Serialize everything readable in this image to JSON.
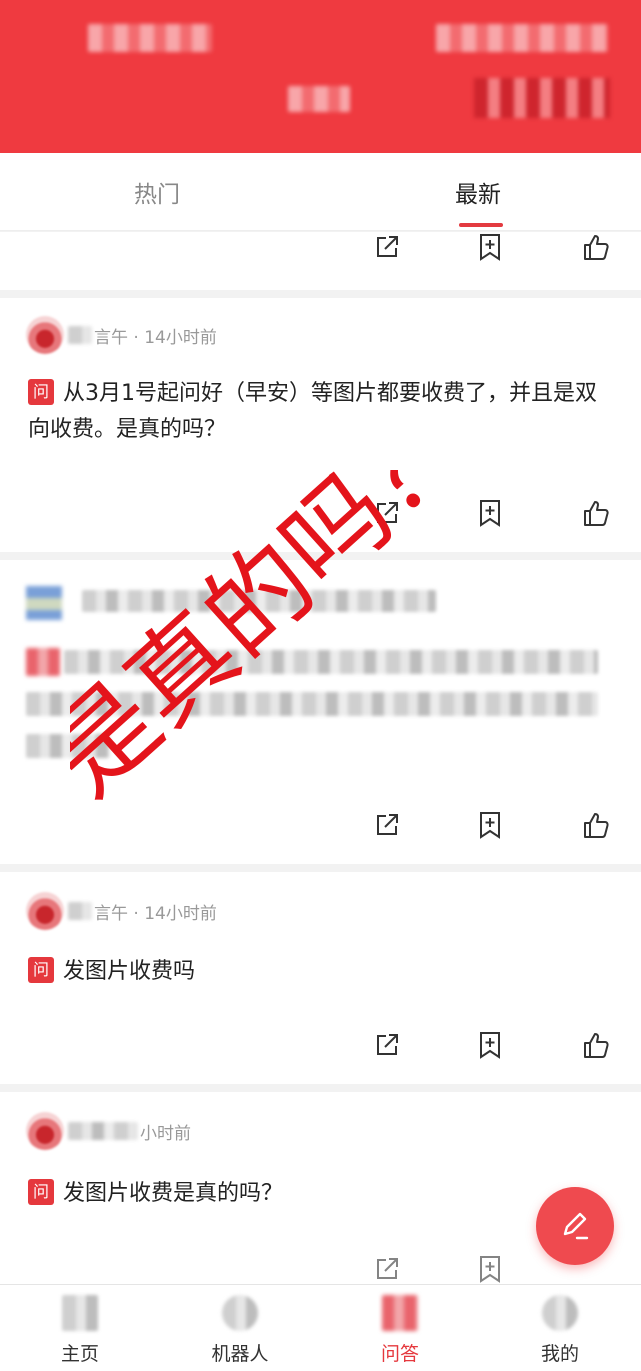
{
  "tabs": {
    "hot": "热门",
    "latest": "最新",
    "active": "latest"
  },
  "posts": [
    {
      "meta": "言午 · 14小时前",
      "badge": "问",
      "text": "从3月1号起问好（早安）等图片都要收费了，并且是双向收费。是真的吗？"
    },
    {
      "meta": "言午 · 14小时前",
      "badge": "问",
      "text": "发图片收费吗"
    },
    {
      "meta": "小时前",
      "badge": "问",
      "text": "发图片收费是真的吗？"
    }
  ],
  "overlay": {
    "text": "是真的吗？",
    "color": "#e4141b"
  },
  "bottom_nav": [
    {
      "label": "主页",
      "icon": "home-icon"
    },
    {
      "label": "机器人",
      "icon": "robot-icon"
    },
    {
      "label": "问答",
      "icon": "qa-icon",
      "active": true
    },
    {
      "label": "我的",
      "icon": "profile-icon"
    }
  ],
  "colors": {
    "brand": "#ef3a40",
    "badge": "#e5383d",
    "muted": "#999999"
  },
  "icons": {
    "share": "share-icon",
    "favorite": "bookmark-add-icon",
    "like": "thumbs-up-icon",
    "compose": "pencil-icon"
  }
}
